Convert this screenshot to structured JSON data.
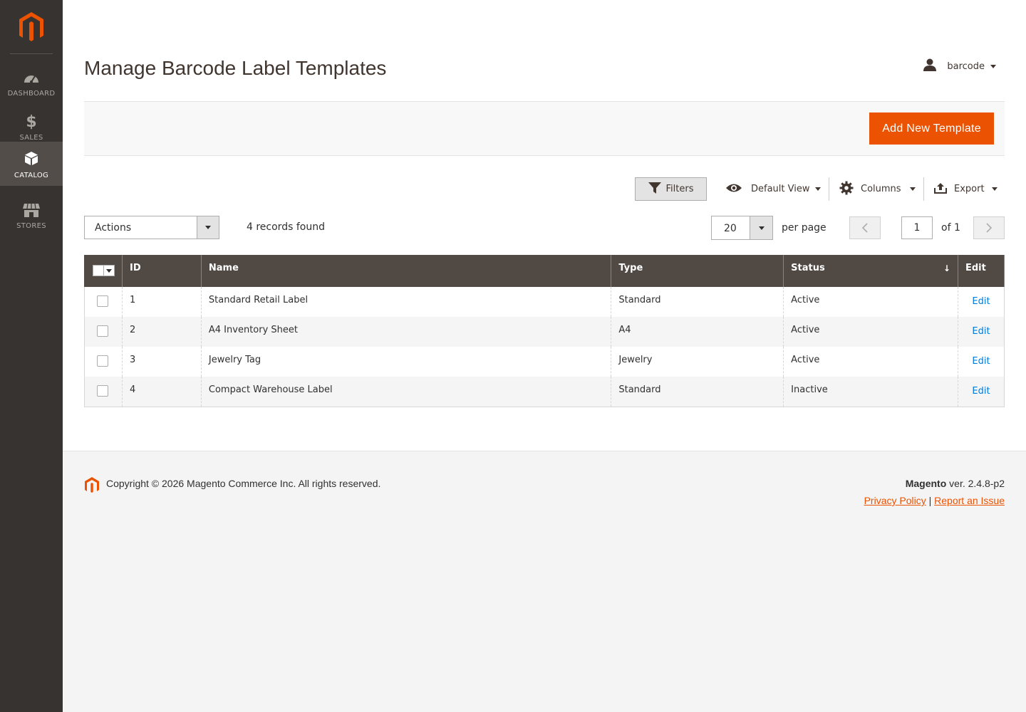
{
  "sidebar": {
    "items": [
      {
        "label": "DASHBOARD",
        "icon": "dashboard-icon"
      },
      {
        "label": "SALES",
        "icon": "dollar-icon"
      },
      {
        "label": "CATALOG",
        "icon": "cube-icon",
        "active": true
      },
      {
        "label": "STORES",
        "icon": "store-icon"
      }
    ]
  },
  "header": {
    "title": "Manage Barcode Label Templates",
    "user": "barcode"
  },
  "action_bar": {
    "add_button": "Add New Template"
  },
  "toolbar": {
    "filters": "Filters",
    "view": "Default View",
    "columns": "Columns",
    "export": "Export"
  },
  "grid_controls": {
    "actions": "Actions",
    "records": "4 records found",
    "per_page_value": "20",
    "per_page_label": "per page",
    "page": "1",
    "of_pages": "of 1"
  },
  "grid": {
    "columns": [
      "ID",
      "Name",
      "Type",
      "Status",
      "Edit"
    ],
    "sort_indicator": "↓",
    "rows": [
      {
        "id": "1",
        "name": "Standard Retail Label",
        "type": "Standard",
        "status": "Active",
        "edit": "Edit"
      },
      {
        "id": "2",
        "name": "A4 Inventory Sheet",
        "type": "A4",
        "status": "Active",
        "edit": "Edit"
      },
      {
        "id": "3",
        "name": "Jewelry Tag",
        "type": "Jewelry",
        "status": "Active",
        "edit": "Edit"
      },
      {
        "id": "4",
        "name": "Compact Warehouse Label",
        "type": "Standard",
        "status": "Inactive",
        "edit": "Edit"
      }
    ]
  },
  "footer": {
    "copyright": "Copyright © 2026 Magento Commerce Inc. All rights reserved.",
    "brand": "Magento",
    "version": "ver. 2.4.8-p2",
    "privacy": "Privacy Policy",
    "separator": "|",
    "report": "Report an Issue"
  },
  "colors": {
    "accent": "#eb5202",
    "sidebar": "#373330",
    "grid_header": "#514943",
    "link": "#007bdb"
  }
}
